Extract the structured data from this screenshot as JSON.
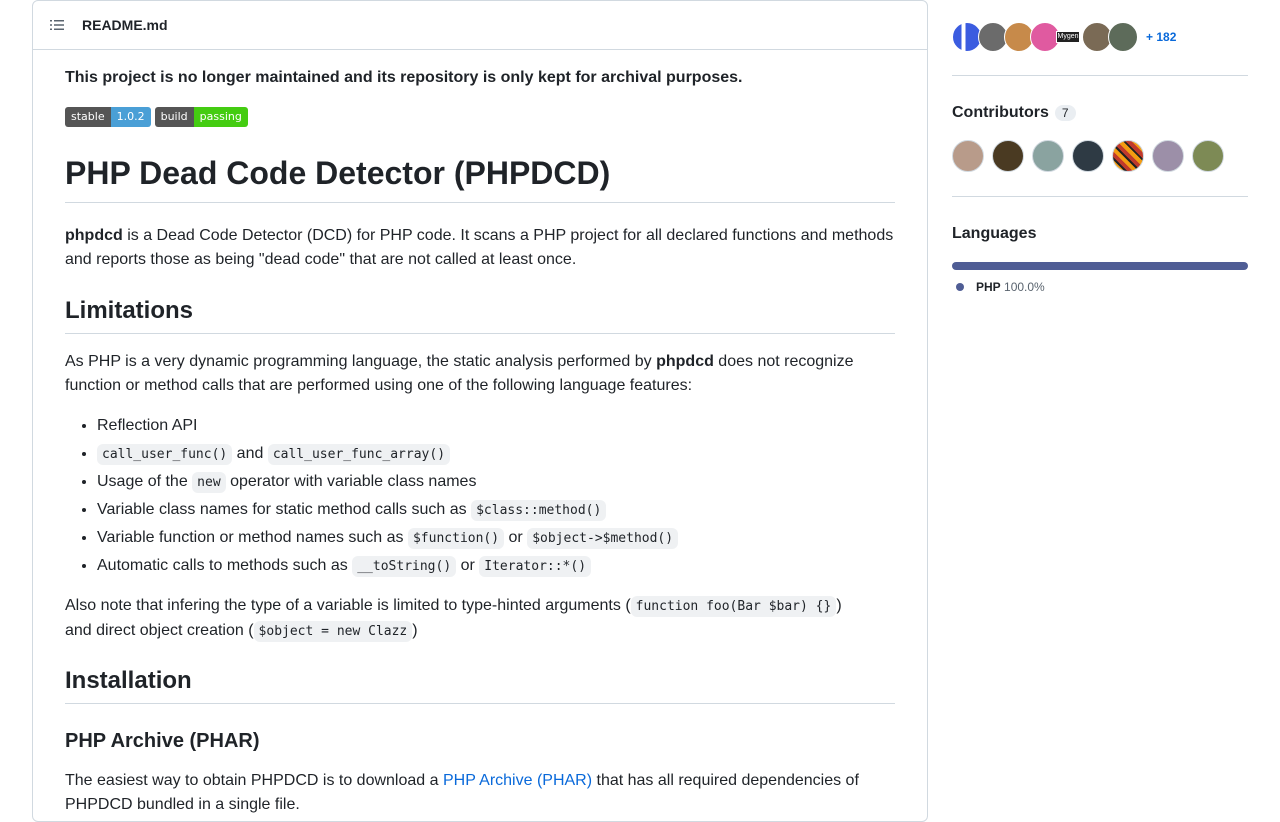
{
  "readme": {
    "title": "README.md",
    "notice": "This project is no longer maintained and its repository is only kept for archival purposes.",
    "badges": [
      {
        "left": "stable",
        "right": "1.0.2",
        "color": "#4a9fd6"
      },
      {
        "left": "build",
        "right": "passing",
        "color": "#4c1"
      }
    ],
    "h1": "PHP Dead Code Detector (PHPDCD)",
    "intro_bold": "phpdcd",
    "intro_rest": " is a Dead Code Detector (DCD) for PHP code. It scans a PHP project for all declared functions and methods and reports those as being \"dead code\" that are not called at least once.",
    "limitations_heading": "Limitations",
    "lim_para_a": "As PHP is a very dynamic programming language, the static analysis performed by ",
    "lim_para_bold": "phpdcd",
    "lim_para_b": " does not recognize function or method calls that are performed using one of the following language features:",
    "list": {
      "i1": "Reflection API",
      "i2_code1": "call_user_func()",
      "i2_and": " and ",
      "i2_code2": "call_user_func_array()",
      "i3_a": "Usage of the ",
      "i3_code": "new",
      "i3_b": " operator with variable class names",
      "i4_a": "Variable class names for static method calls such as ",
      "i4_code": "$class::method()",
      "i5_a": "Variable function or method names such as ",
      "i5_code1": "$function()",
      "i5_or": " or ",
      "i5_code2": "$object->$method()",
      "i6_a": "Automatic calls to methods such as ",
      "i6_code1": "__toString()",
      "i6_or": " or ",
      "i6_code2": "Iterator::*()"
    },
    "note_a": "Also note that infering the type of a variable is limited to type-hinted arguments (",
    "note_code1": "function foo(Bar $bar) {}",
    "note_b": ")",
    "note_c": "and direct object creation (",
    "note_code2": "$object = new Clazz",
    "note_d": ")",
    "installation_heading": "Installation",
    "phar_heading": "PHP Archive (PHAR)",
    "phar_para_a": "The easiest way to obtain PHPDCD is to download a ",
    "phar_link": "PHP Archive (PHAR)",
    "phar_para_b": " that has all required dependencies of",
    "phar_para_c": "PHPDCD bundled in a single file."
  },
  "sidebar": {
    "used_by_more": "+ 182",
    "used_by_label": "Mygen",
    "contributors_heading": "Contributors",
    "contributors_count": "7",
    "languages_heading": "Languages",
    "language_name": "PHP",
    "language_percent": "100.0%",
    "language_color": "#4F5D95"
  }
}
